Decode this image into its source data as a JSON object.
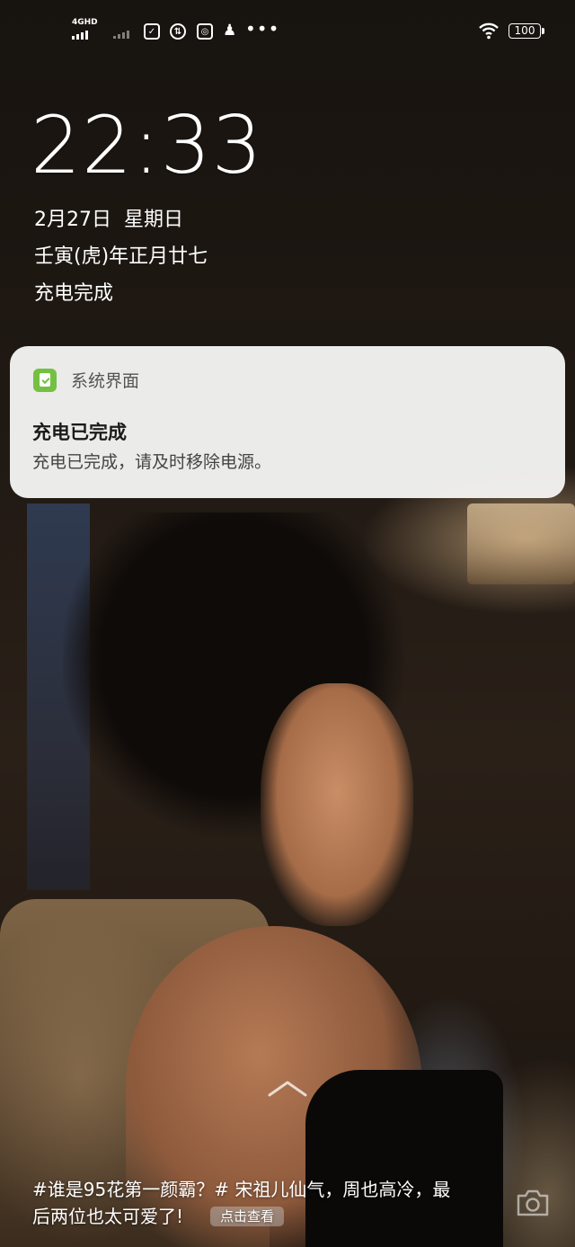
{
  "status_bar": {
    "network": "4GHD",
    "battery": "100",
    "icons": [
      "battery-saver-icon",
      "data-usage-icon",
      "scan-icon",
      "qq-icon",
      "more-icon",
      "wifi-icon"
    ]
  },
  "lockscreen": {
    "time": "22:33",
    "date": "2月27日",
    "weekday": "星期日",
    "lunar_date": "壬寅(虎)年正月廿七",
    "charge_status": "充电完成"
  },
  "notification": {
    "app_name": "系统界面",
    "title": "充电已完成",
    "body": "充电已完成，请及时移除电源。",
    "app_icon_color": "#74c043"
  },
  "caption": {
    "line1": "#谁是95花第一颜霸？# 宋祖儿仙气，周也高冷，最",
    "line2": "后两位也太可爱了!",
    "button_label": "点击查看"
  }
}
